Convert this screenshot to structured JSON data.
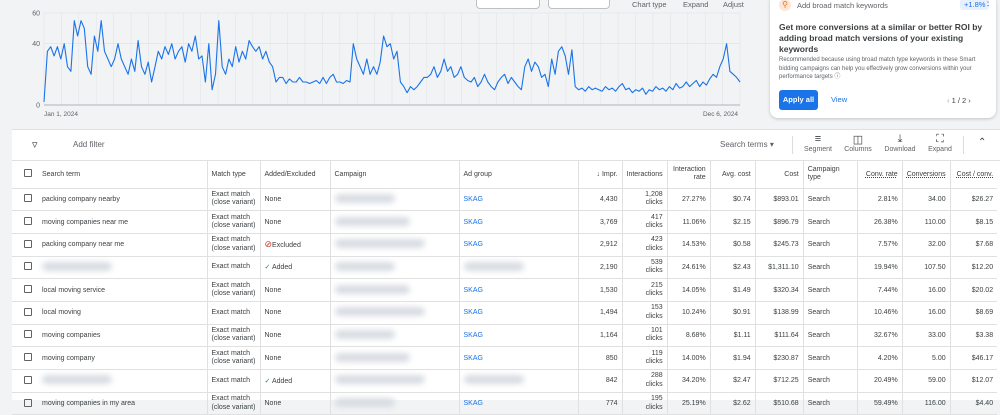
{
  "chart_controls": {
    "chart_type": "Chart type",
    "expand": "Expand",
    "adjust": "Adjust"
  },
  "chart_data": {
    "type": "line",
    "y_ticks": [
      "0",
      "40",
      "60"
    ],
    "ylim": [
      0,
      60
    ],
    "x_labels": [
      "Jan 1, 2024",
      "Dec 6, 2024"
    ],
    "color": "#1a73e8",
    "values": [
      2,
      35,
      38,
      32,
      38,
      30,
      40,
      25,
      22,
      55,
      45,
      55,
      50,
      25,
      20,
      45,
      35,
      55,
      35,
      30,
      25,
      30,
      40,
      30,
      25,
      20,
      30,
      22,
      42,
      25,
      20,
      28,
      15,
      25,
      35,
      30,
      38,
      33,
      40,
      30,
      35,
      38,
      28,
      40,
      35,
      45,
      30,
      32,
      15,
      40,
      10,
      20,
      55,
      25,
      20,
      30,
      25,
      38,
      28,
      35,
      30,
      42,
      38,
      35,
      38,
      30,
      35,
      28,
      25,
      15,
      18,
      18,
      14,
      17,
      15,
      15,
      18,
      15,
      15,
      14,
      15,
      16,
      14,
      18,
      14,
      18,
      20,
      15,
      15,
      14,
      16,
      15,
      40,
      30,
      25,
      20,
      30,
      20,
      25,
      20,
      28,
      45,
      38,
      40,
      30,
      35,
      15,
      12,
      8,
      12,
      10,
      12,
      15,
      18,
      18,
      20,
      25,
      18,
      22,
      30,
      22,
      25,
      18,
      20,
      25,
      18,
      16,
      15,
      18,
      12,
      15,
      20,
      15,
      12,
      10,
      15,
      18,
      20,
      14,
      18,
      15,
      12,
      10,
      25,
      30,
      22,
      28,
      25,
      18,
      20,
      12,
      30,
      20,
      35,
      38,
      32,
      20,
      36,
      12,
      10,
      11,
      9,
      12,
      10,
      11,
      10,
      9,
      12,
      10,
      11,
      9,
      12,
      14,
      10,
      11,
      8,
      10,
      9,
      11,
      7,
      10,
      9,
      12,
      10,
      11,
      9,
      12,
      10,
      14,
      11,
      12,
      15,
      12,
      14,
      16,
      12,
      15,
      13,
      17,
      20,
      18,
      25,
      30,
      40,
      22,
      20,
      18,
      15
    ]
  },
  "recommendation": {
    "label": "Add broad match keywords",
    "badge": "+1.8%",
    "title": "Get more conversions at a similar or better ROI by adding broad match versions of your existing keywords",
    "description": "Recommended because using broad match type keywords in these Smart bidding campaigns can help you effectively grow conversions within your performance targets",
    "apply": "Apply all",
    "view": "View",
    "pager": "1 / 2",
    "accent": "#1a73e8"
  },
  "toolbar": {
    "add_filter": "Add filter",
    "search_terms": "Search terms",
    "segment": "Segment",
    "columns": "Columns",
    "download": "Download",
    "expand": "Expand"
  },
  "table": {
    "headers": [
      "Search term",
      "Match type",
      "Added/Excluded",
      "Campaign",
      "Ad group",
      "Impr.",
      "Interactions",
      "Interaction rate",
      "Avg. cost",
      "Cost",
      "Campaign type",
      "Conv. rate",
      "Conversions",
      "Cost / conv."
    ],
    "rows": [
      {
        "term": "packing company nearby",
        "match": "Exact match (close variant)",
        "status": "None",
        "adgroup": "SKAG",
        "impr": "4,430",
        "inter": "1,208",
        "unit": "clicks",
        "rate": "27.27%",
        "avg": "$0.74",
        "cost": "$893.01",
        "ctype": "Search",
        "conv_rate": "2.81%",
        "conv": "34.00",
        "cpc": "$26.27"
      },
      {
        "term": "moving companies near me",
        "match": "Exact match (close variant)",
        "status": "None",
        "adgroup": "SKAG",
        "impr": "3,769",
        "inter": "417",
        "unit": "clicks",
        "rate": "11.06%",
        "avg": "$2.15",
        "cost": "$896.79",
        "ctype": "Search",
        "conv_rate": "26.38%",
        "conv": "110.00",
        "cpc": "$8.15"
      },
      {
        "term": "packing company near me",
        "match": "Exact match (close variant)",
        "status": "Excluded",
        "adgroup": "SKAG",
        "impr": "2,912",
        "inter": "423",
        "unit": "clicks",
        "rate": "14.53%",
        "avg": "$0.58",
        "cost": "$245.73",
        "ctype": "Search",
        "conv_rate": "7.57%",
        "conv": "32.00",
        "cpc": "$7.68"
      },
      {
        "term": "",
        "match": "Exact match",
        "status": "Added",
        "adgroup": "",
        "impr": "2,190",
        "inter": "539",
        "unit": "clicks",
        "rate": "24.61%",
        "avg": "$2.43",
        "cost": "$1,311.10",
        "ctype": "Search",
        "conv_rate": "19.94%",
        "conv": "107.50",
        "cpc": "$12.20"
      },
      {
        "term": "local moving service",
        "match": "Exact match (close variant)",
        "status": "None",
        "adgroup": "SKAG",
        "impr": "1,530",
        "inter": "215",
        "unit": "clicks",
        "rate": "14.05%",
        "avg": "$1.49",
        "cost": "$320.34",
        "ctype": "Search",
        "conv_rate": "7.44%",
        "conv": "16.00",
        "cpc": "$20.02"
      },
      {
        "term": "local moving",
        "match": "Exact match",
        "status": "None",
        "adgroup": "SKAG",
        "impr": "1,494",
        "inter": "153",
        "unit": "clicks",
        "rate": "10.24%",
        "avg": "$0.91",
        "cost": "$138.99",
        "ctype": "Search",
        "conv_rate": "10.46%",
        "conv": "16.00",
        "cpc": "$8.69"
      },
      {
        "term": "moving companies",
        "match": "Exact match (close variant)",
        "status": "None",
        "adgroup": "SKAG",
        "impr": "1,164",
        "inter": "101",
        "unit": "clicks",
        "rate": "8.68%",
        "avg": "$1.11",
        "cost": "$111.64",
        "ctype": "Search",
        "conv_rate": "32.67%",
        "conv": "33.00",
        "cpc": "$3.38"
      },
      {
        "term": "moving company",
        "match": "Exact match (close variant)",
        "status": "None",
        "adgroup": "SKAG",
        "impr": "850",
        "inter": "119",
        "unit": "clicks",
        "rate": "14.00%",
        "avg": "$1.94",
        "cost": "$230.87",
        "ctype": "Search",
        "conv_rate": "4.20%",
        "conv": "5.00",
        "cpc": "$46.17"
      },
      {
        "term": "",
        "match": "Exact match",
        "status": "Added",
        "adgroup": "",
        "impr": "842",
        "inter": "288",
        "unit": "clicks",
        "rate": "34.20%",
        "avg": "$2.47",
        "cost": "$712.25",
        "ctype": "Search",
        "conv_rate": "20.49%",
        "conv": "59.00",
        "cpc": "$12.07"
      },
      {
        "term": "moving companies in my area",
        "match": "Exact match (close variant)",
        "status": "None",
        "adgroup": "SKAG",
        "impr": "774",
        "inter": "195",
        "unit": "clicks",
        "rate": "25.19%",
        "avg": "$2.62",
        "cost": "$510.68",
        "ctype": "Search",
        "conv_rate": "59.49%",
        "conv": "116.00",
        "cpc": "$4.40"
      }
    ]
  }
}
